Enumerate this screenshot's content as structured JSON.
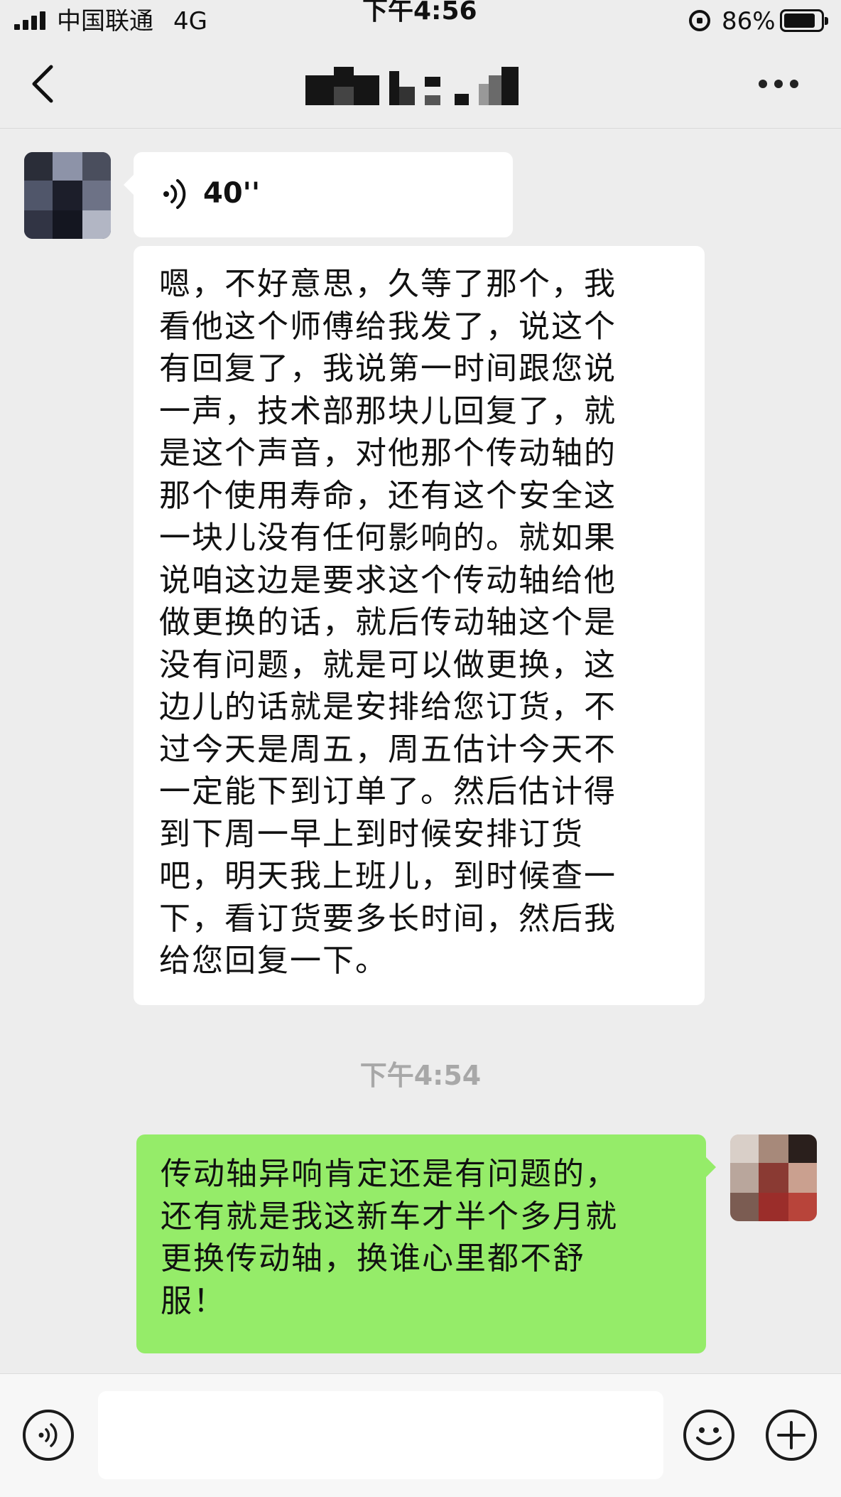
{
  "status_bar": {
    "carrier": "中国联通",
    "network": "4G",
    "time": "下午4:56",
    "battery_percent": "86%",
    "battery_level": 0.86,
    "icons": [
      "signal-icon",
      "rotation-lock-icon",
      "battery-icon"
    ]
  },
  "nav": {
    "back_icon": "chevron-left-icon",
    "title_pixelated": true,
    "more_icon": "more-dots-icon"
  },
  "messages": [
    {
      "side": "left",
      "type": "voice",
      "duration": "40''"
    },
    {
      "side": "left",
      "type": "text",
      "text": "嗯，不好意思，久等了那个，我\n看他这个师傅给我发了，说这个\n有回复了，我说第一时间跟您说\n一声，技术部那块儿回复了，就\n是这个声音，对他那个传动轴的\n那个使用寿命，还有这个安全这\n一块儿没有任何影响的。就如果\n说咱这边是要求这个传动轴给他\n做更换的话，就后传动轴这个是\n没有问题，就是可以做更换，这\n边儿的话就是安排给您订货，不\n过今天是周五，周五估计今天不\n一定能下到订单了。然后估计得\n到下周一早上到时候安排订货\n吧，明天我上班儿，到时候查一\n下，看订货要多长时间，然后我\n给您回复一下。"
    },
    {
      "side": "center",
      "type": "time",
      "text": "下午4:54"
    },
    {
      "side": "right",
      "type": "text",
      "text": "传动轴异响肯定还是有问题的，\n还有就是我这新车才半个多月就\n更换传动轴，换谁心里都不舒\n服！"
    }
  ],
  "input_bar": {
    "voice_icon": "voice-input-icon",
    "input_value": "",
    "emoji_icon": "emoji-icon",
    "plus_icon": "plus-icon"
  },
  "colors": {
    "background": "#ededed",
    "left_bubble": "#ffffff",
    "right_bubble": "#95ec69",
    "timestamp": "#a8a8a8"
  }
}
